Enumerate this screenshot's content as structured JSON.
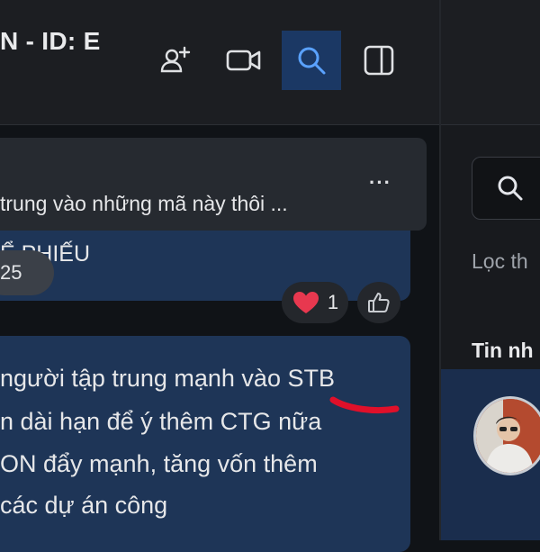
{
  "header": {
    "title": "N - ID: E",
    "buttons": [
      {
        "name": "add-member-icon"
      },
      {
        "name": "video-call-icon"
      },
      {
        "name": "search-icon",
        "active": true
      },
      {
        "name": "toggle-panel-icon"
      }
    ]
  },
  "pinned": {
    "text": "trung vào những mã này thôi ...",
    "more_label": "···"
  },
  "messages": [
    {
      "text": "Ể PHIẾU",
      "reactions": {
        "emoji": "heart-icon",
        "count": "1"
      }
    },
    {
      "lines": [
        "người tập trung mạnh vào STB",
        "n dài hạn để ý thêm CTG nữa",
        "ON đẩy mạnh, tăng vốn thêm",
        "các dự án công"
      ]
    }
  ],
  "date_pill": "25",
  "right_panel": {
    "search_icon": "search-icon",
    "filter_label": "Lọc th",
    "section_title": "Tin nh"
  },
  "colors": {
    "accent": "#1b3864",
    "bubble": "#1e3557",
    "annotation_red": "#e0102a"
  }
}
